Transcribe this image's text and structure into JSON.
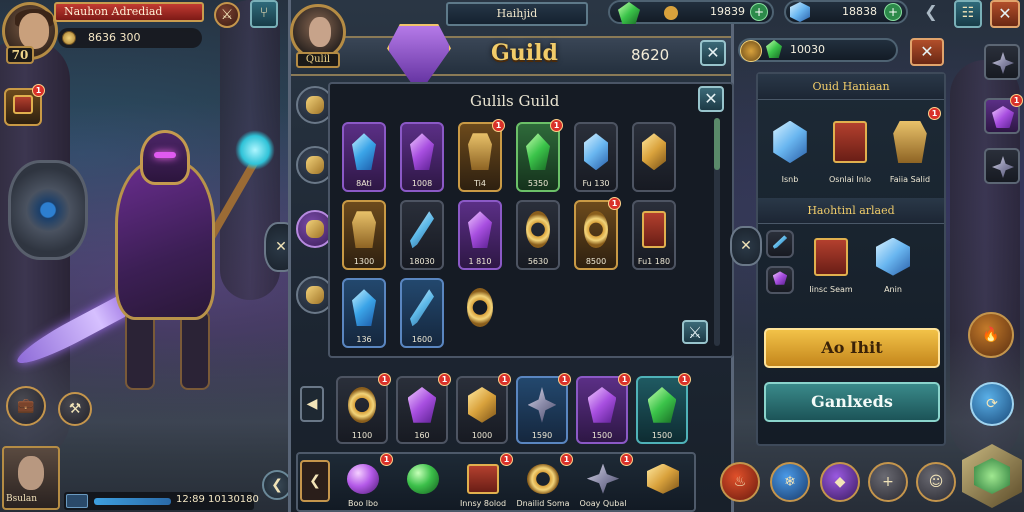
{
  "player": {
    "name": "Nauhon Adrediad",
    "level": "70",
    "gold": "8636 300"
  },
  "top_center": {
    "label": "Haihjid"
  },
  "resources": [
    {
      "icon": "green-gem-icon",
      "value": "19839"
    },
    {
      "icon": "blue-gem-icon",
      "value": "18838"
    }
  ],
  "guild_panel": {
    "title": "Guild",
    "count": "8620",
    "avatar_label": "Qulil",
    "inner_title": "Gulils Guild",
    "secondary_value": "10030"
  },
  "items_grid": [
    {
      "name": "crystal-blue",
      "caption": "8Ati",
      "rarity": "purple",
      "gem": "gem-crystal-blue"
    },
    {
      "name": "crystal-purple",
      "caption": "1008",
      "rarity": "purple",
      "gem": "gem-crystal-purple"
    },
    {
      "name": "gold-armor",
      "caption": "Ti4",
      "rarity": "gold",
      "gem": "gem-armor",
      "badge": "1"
    },
    {
      "name": "green-gem",
      "caption": "5350",
      "rarity": "green",
      "gem": "gem-green",
      "badge": "1"
    },
    {
      "name": "ice-cube",
      "caption": "Fu 130",
      "rarity": "dark",
      "gem": "gem-cube"
    },
    {
      "name": "gold-cube",
      "caption": "",
      "rarity": "dark",
      "gem": "gem-gold"
    },
    {
      "name": "gold-shield",
      "caption": "1300",
      "rarity": "gold",
      "gem": "gem-armor"
    },
    {
      "name": "ice-sword",
      "caption": "18030",
      "rarity": "dark",
      "gem": "gem-sword"
    },
    {
      "name": "purple-crystal-2",
      "caption": "1 810",
      "rarity": "purple",
      "gem": "gem-crystal-purple"
    },
    {
      "name": "gold-ring",
      "caption": "5630",
      "rarity": "dark",
      "gem": "gem-ring"
    },
    {
      "name": "gold-ring-2",
      "caption": "8500",
      "rarity": "gold",
      "gem": "gem-ring",
      "badge": "1"
    },
    {
      "name": "red-chest",
      "caption": "Fu1 180",
      "rarity": "dark",
      "gem": "gem-chest"
    },
    {
      "name": "blue-crystal-3",
      "caption": "136",
      "rarity": "blue",
      "gem": "gem-crystal-blue"
    },
    {
      "name": "blue-sword-2",
      "caption": "1600",
      "rarity": "blue",
      "gem": "gem-sword"
    },
    {
      "name": "gold-rings-3",
      "caption": "",
      "rarity": "none",
      "gem": "gem-ring"
    }
  ],
  "bottom_row": [
    {
      "caption": "1100",
      "rarity": "dark",
      "gem": "gem-ring",
      "badge": "1"
    },
    {
      "caption": "160",
      "rarity": "dark",
      "gem": "gem-crystal-purple",
      "badge": "1"
    },
    {
      "caption": "1000",
      "rarity": "dark",
      "gem": "gem-gold",
      "badge": "1"
    },
    {
      "caption": "1590",
      "rarity": "blue",
      "gem": "gem-spiky",
      "badge": "1"
    },
    {
      "caption": "1500",
      "rarity": "purple",
      "gem": "gem-crystal-purple",
      "badge": "1"
    },
    {
      "caption": "1500",
      "rarity": "teal",
      "gem": "gem-green",
      "badge": "1"
    }
  ],
  "bottom_bar_items": [
    {
      "caption": "Boo lbo",
      "gem": "gem-purple-orb",
      "badge": "1"
    },
    {
      "caption": "",
      "gem": "gem-orb"
    },
    {
      "caption": "Innsy 8olod",
      "gem": "gem-chest",
      "badge": "1"
    },
    {
      "caption": "Dnailid Soma",
      "gem": "gem-ring",
      "badge": "1"
    },
    {
      "caption": "Ooay Qubal",
      "gem": "gem-spiky",
      "badge": "1"
    },
    {
      "caption": "",
      "gem": "gem-gold"
    }
  ],
  "right_panel": {
    "section1_title": "Ouid Haniaan",
    "section1_items": [
      {
        "caption": "Isnb",
        "gem": "gem-cube"
      },
      {
        "caption": "Osnlai Inlo",
        "gem": "gem-chest"
      },
      {
        "caption": "Faiia Salid",
        "gem": "gem-armor",
        "badge": "1"
      }
    ],
    "section2_title": "Haohtinl arlaed",
    "section2_items": [
      {
        "caption": "Iinsc Seam",
        "gem": "gem-chest"
      },
      {
        "caption": "Anin",
        "gem": "gem-cube"
      }
    ],
    "primary_button": "Ao Ihit",
    "secondary_button": "Ganlxeds"
  },
  "left_quest": {
    "badge": "1"
  },
  "bottom_left": {
    "label": "Bsulan",
    "xp_text": "12:89 10130180",
    "xp_fraction": 0.55
  },
  "colors": {
    "accent_gold": "#f1cc6a",
    "primary_button": "#f2c248",
    "secondary_button": "#3a8a8a",
    "close_red": "#b14e2a"
  }
}
